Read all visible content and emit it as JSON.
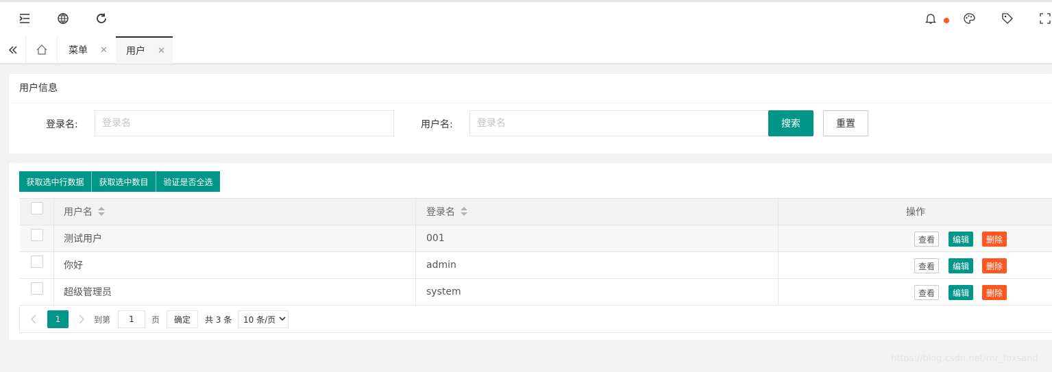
{
  "header": {
    "icons": [
      "menu-fold-icon",
      "globe-icon",
      "refresh-icon",
      "bell-icon",
      "palette-icon",
      "tag-icon",
      "fullscreen-icon"
    ],
    "notification_color": "#ff5722"
  },
  "tabs": [
    {
      "label": "菜单",
      "active": false
    },
    {
      "label": "用户",
      "active": true
    }
  ],
  "search": {
    "title": "用户信息",
    "login_label": "登录名:",
    "login_placeholder": "登录名",
    "user_label": "用户名:",
    "user_placeholder": "登录名",
    "search_btn": "搜索",
    "reset_btn": "重置"
  },
  "toolbar": {
    "btn1": "获取选中行数据",
    "btn2": "获取选中数目",
    "btn3": "验证是否全选"
  },
  "table": {
    "columns": [
      "用户名",
      "登录名",
      "操作"
    ],
    "rows": [
      {
        "username": "测试用户",
        "login": "001"
      },
      {
        "username": "你好",
        "login": "admin"
      },
      {
        "username": "超级管理员",
        "login": "system"
      }
    ],
    "actions": {
      "view": "查看",
      "edit": "编辑",
      "delete": "删除"
    }
  },
  "pager": {
    "current": "1",
    "goto_label": "到第",
    "goto_value": "1",
    "page_unit": "页",
    "confirm": "确定",
    "total": "共 3 条",
    "page_size": "10 条/页"
  },
  "colors": {
    "primary": "#009688",
    "danger": "#ff5722"
  },
  "watermark": "https://blog.csdn.net/mr_foxsand"
}
